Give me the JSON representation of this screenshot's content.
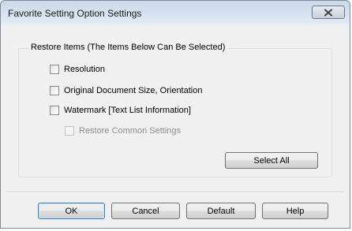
{
  "window": {
    "title": "Favorite Setting Option Settings",
    "close_icon": "close-icon"
  },
  "restore_group": {
    "legend": "Restore Items (The Items Below Can Be Selected)",
    "items": [
      {
        "label": "Resolution",
        "checked": false,
        "enabled": true
      },
      {
        "label": "Original Document Size, Orientation",
        "checked": false,
        "enabled": true
      },
      {
        "label": "Watermark [Text List Information]",
        "checked": false,
        "enabled": true
      },
      {
        "label": "Restore Common Settings",
        "checked": false,
        "enabled": false
      }
    ],
    "select_all_label": "Select All"
  },
  "footer": {
    "ok_label": "OK",
    "cancel_label": "Cancel",
    "default_label": "Default",
    "help_label": "Help"
  }
}
